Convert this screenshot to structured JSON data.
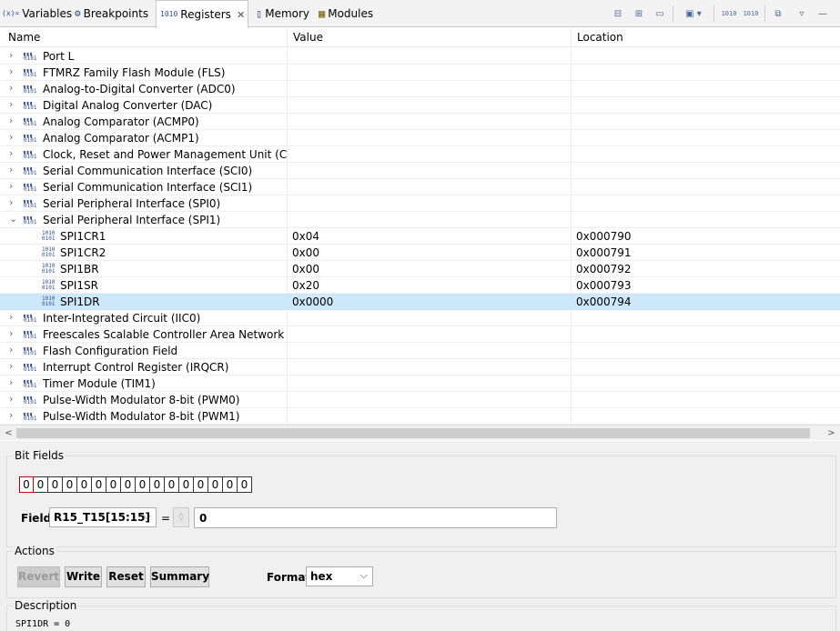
{
  "tabs": [
    {
      "icon": "(x)=",
      "label": "Variables",
      "active": false
    },
    {
      "icon": "⚙",
      "label": "Breakpoints",
      "active": false
    },
    {
      "icon": "1010",
      "label": "Registers",
      "active": true
    },
    {
      "icon": "▯",
      "label": "Memory",
      "active": false
    },
    {
      "icon": "▦",
      "label": "Modules",
      "active": false
    }
  ],
  "table": {
    "headers": {
      "name": "Name",
      "value": "Value",
      "location": "Location"
    },
    "rows": [
      {
        "type": "group",
        "name": "Port L",
        "expanded": false
      },
      {
        "type": "group",
        "name": "FTMRZ Family Flash Module (FLS)",
        "expanded": false
      },
      {
        "type": "group",
        "name": "Analog-to-Digital Converter (ADC0)",
        "expanded": false
      },
      {
        "type": "group",
        "name": "Digital Analog Converter (DAC)",
        "expanded": false
      },
      {
        "type": "group",
        "name": "Analog Comparator (ACMP0)",
        "expanded": false
      },
      {
        "type": "group",
        "name": "Analog Comparator (ACMP1)",
        "expanded": false
      },
      {
        "type": "group",
        "name": "Clock, Reset and Power Management Unit (CPMU)",
        "expanded": false
      },
      {
        "type": "group",
        "name": "Serial Communication Interface (SCI0)",
        "expanded": false
      },
      {
        "type": "group",
        "name": "Serial Communication Interface (SCI1)",
        "expanded": false
      },
      {
        "type": "group",
        "name": "Serial Peripheral Interface (SPI0)",
        "expanded": false
      },
      {
        "type": "group",
        "name": "Serial Peripheral Interface (SPI1)",
        "expanded": true
      },
      {
        "type": "reg",
        "name": "SPI1CR1",
        "value": "0x04",
        "location": "0x000790"
      },
      {
        "type": "reg",
        "name": "SPI1CR2",
        "value": "0x00",
        "location": "0x000791"
      },
      {
        "type": "reg",
        "name": "SPI1BR",
        "value": "0x00",
        "location": "0x000792"
      },
      {
        "type": "reg",
        "name": "SPI1SR",
        "value": "0x20",
        "location": "0x000793"
      },
      {
        "type": "reg",
        "name": "SPI1DR",
        "value": "0x0000",
        "location": "0x000794",
        "selected": true
      },
      {
        "type": "group",
        "name": "Inter-Integrated Circuit (IIC0)",
        "expanded": false
      },
      {
        "type": "group",
        "name": "Freescales Scalable Controller Area Network (MSCAN)",
        "expanded": false
      },
      {
        "type": "group",
        "name": "Flash Configuration Field",
        "expanded": false
      },
      {
        "type": "group",
        "name": "Interrupt Control Register (IRQCR)",
        "expanded": false
      },
      {
        "type": "group",
        "name": "Timer Module (TIM1)",
        "expanded": false
      },
      {
        "type": "group",
        "name": "Pulse-Width Modulator 8-bit (PWM0)",
        "expanded": false
      },
      {
        "type": "group",
        "name": "Pulse-Width Modulator 8-bit (PWM1)",
        "expanded": false
      }
    ]
  },
  "bitfields": {
    "title": "Bit Fields",
    "bits": [
      "0",
      "0",
      "0",
      "0",
      "0",
      "0",
      "0",
      "0",
      "0",
      "0",
      "0",
      "0",
      "0",
      "0",
      "0",
      "0"
    ],
    "field_label": "Field",
    "field_value": "R15_T15[15:15]",
    "equals": "=",
    "field_input": "0"
  },
  "actions": {
    "title": "Actions",
    "revert": "Revert",
    "write": "Write",
    "reset": "Reset",
    "summary": "Summary",
    "format_label": "Format",
    "format_value": "hex"
  },
  "description": {
    "title": "Description",
    "text": "SPI1DR = 0"
  },
  "colors": {
    "selection": "#cde8fa",
    "accent": "#2e4e8a"
  }
}
